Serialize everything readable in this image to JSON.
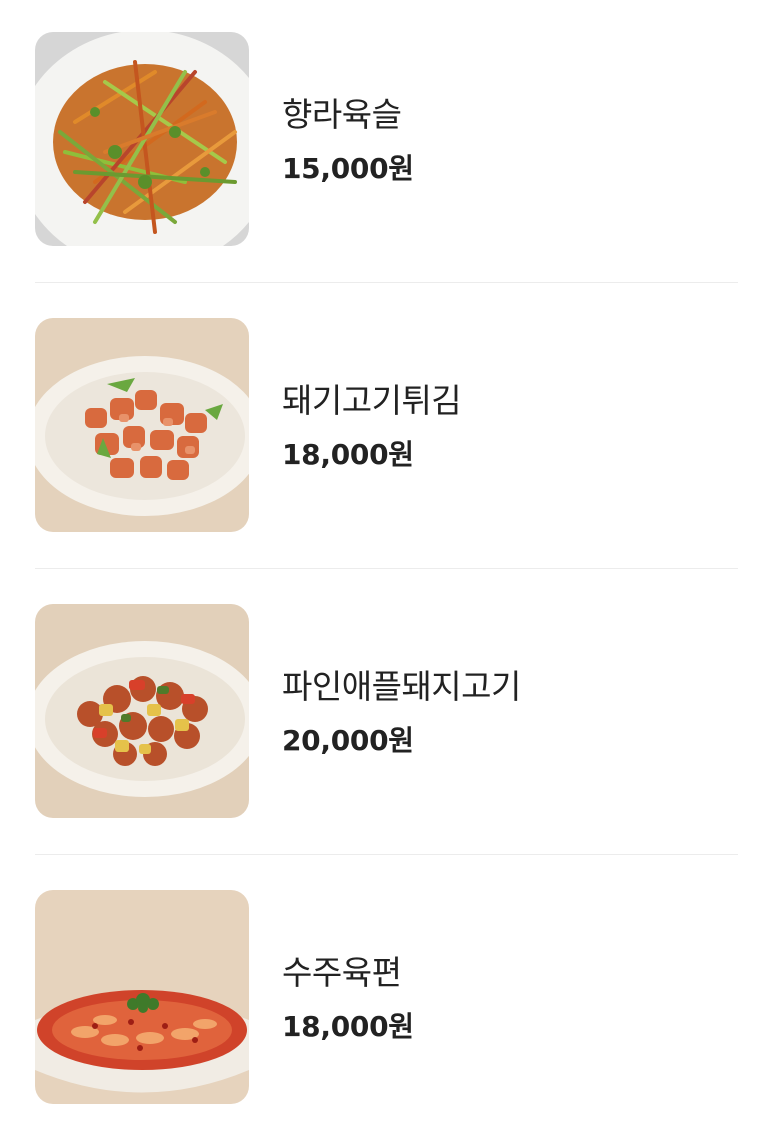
{
  "menu": {
    "items": [
      {
        "name": "향라육슬",
        "price": "15,000원",
        "photo": "shredded-pork-dish-photo"
      },
      {
        "name": "돼기고기튀김",
        "price": "18,000원",
        "photo": "fried-pork-dish-photo"
      },
      {
        "name": "파인애플돼지고기",
        "price": "20,000원",
        "photo": "pineapple-pork-dish-photo"
      },
      {
        "name": "수주육편",
        "price": "18,000원",
        "photo": "spicy-boiled-pork-dish-photo"
      }
    ]
  },
  "colors": {
    "text": "#222222",
    "divider": "#ececec",
    "background": "#ffffff"
  }
}
